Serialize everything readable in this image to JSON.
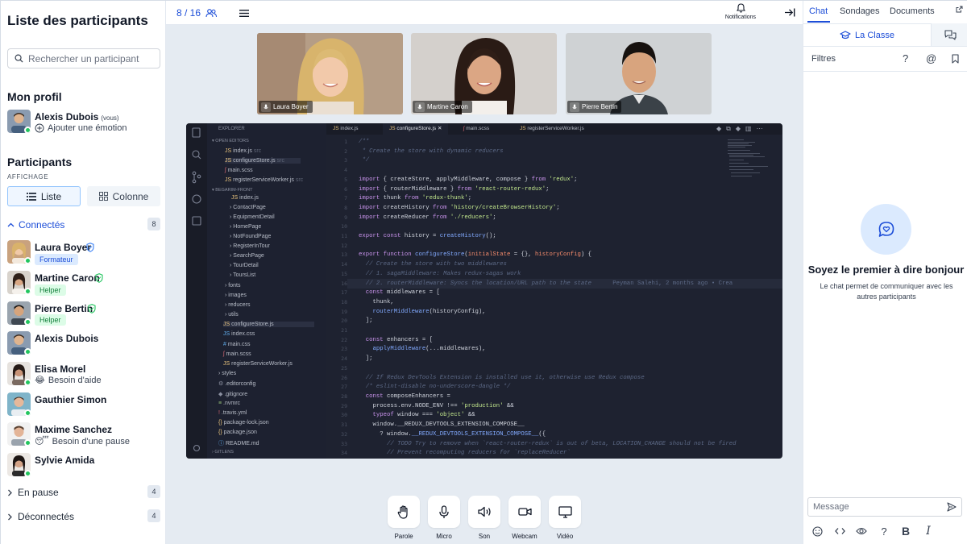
{
  "left": {
    "title": "Liste des participants",
    "search_placeholder": "Rechercher un participant",
    "my_profile": {
      "heading": "Mon profil",
      "name": "Alexis Dubois",
      "you_tag": "(vous)",
      "add_emotion": "Ajouter une émotion"
    },
    "participants_heading": "Participants",
    "display_label": "AFFICHAGE",
    "view_list": "Liste",
    "view_columns": "Colonne",
    "connected_label": "Connectés",
    "connected_count": "8",
    "people": [
      {
        "name": "Laura Boyer",
        "badge": "Formateur",
        "shield": true
      },
      {
        "name": "Martine Caron",
        "badge": "Helper",
        "shield": true
      },
      {
        "name": "Pierre Bertin",
        "badge": "Helper",
        "shield": true
      },
      {
        "name": "Alexis Dubois"
      },
      {
        "name": "Elisa Morel",
        "status_emoji": "😂",
        "status": "Besoin d'aide"
      },
      {
        "name": "Gauthier Simon"
      },
      {
        "name": "Maxime Sanchez",
        "status_emoji": "😴",
        "status": "Besoin d'une pause"
      },
      {
        "name": "Sylvie Amida"
      }
    ],
    "paused_label": "En pause",
    "paused_count": "4",
    "disconnected_label": "Déconnectés",
    "disconnected_count": "4"
  },
  "topbar": {
    "participant_count": "8 / 16",
    "notifications_label": "Notifications"
  },
  "videos": [
    {
      "name": "Laura Boyer"
    },
    {
      "name": "Martine Caron"
    },
    {
      "name": "Pierre Bertin"
    }
  ],
  "editor": {
    "explorer_title": "EXPLORER",
    "open_editors": "OPEN EDITORS",
    "project": "BEGARIM-FRONT",
    "gitlens": "GITLENS",
    "open_files": [
      {
        "name": "index.js",
        "suffix": "src"
      },
      {
        "name": "configureStore.js",
        "suffix": "src"
      },
      {
        "name": "main.scss",
        "suffix": ""
      },
      {
        "name": "registerServiceWorker.js",
        "suffix": "src"
      }
    ],
    "tree": [
      "index.js",
      "ContactPage",
      "EquipmentDetail",
      "HomePage",
      "NotFoundPage",
      "RegisterInTour",
      "SearchPage",
      "TourDetail",
      "ToursList",
      "fonts",
      "images",
      "reducers",
      "utils",
      "configureStore.js",
      "index.css",
      "main.css",
      "main.scss",
      "registerServiceWorker.js",
      "styles",
      ".editorconfig",
      ".gitignore",
      ".nvmrc",
      ".travis.yml",
      "package-lock.json",
      "package.json",
      "README.md"
    ],
    "tabs": [
      "index.js",
      "configureStore.js",
      "main.scss",
      "registerServiceWorker.js"
    ],
    "blame": "Peyman Salehi, 2 months ago • Crea"
  },
  "controls": [
    {
      "label": "Parole",
      "icon": "hand-icon"
    },
    {
      "label": "Micro",
      "icon": "microphone-icon"
    },
    {
      "label": "Son",
      "icon": "speaker-icon"
    },
    {
      "label": "Webcam",
      "icon": "camera-icon"
    },
    {
      "label": "Vidéo",
      "icon": "screen-share-icon"
    }
  ],
  "chat": {
    "tabs": [
      "Chat",
      "Sondages",
      "Documents"
    ],
    "room": "La Classe",
    "filters": "Filtres",
    "empty_title": "Soyez le premier à dire bonjour",
    "empty_subtitle": "Le chat permet de communiquer avec les autres participants",
    "message_placeholder": "Message"
  },
  "colors": {
    "accent": "#1d4ed8",
    "online": "#22c55e",
    "main_bg": "#e5ebf2"
  }
}
